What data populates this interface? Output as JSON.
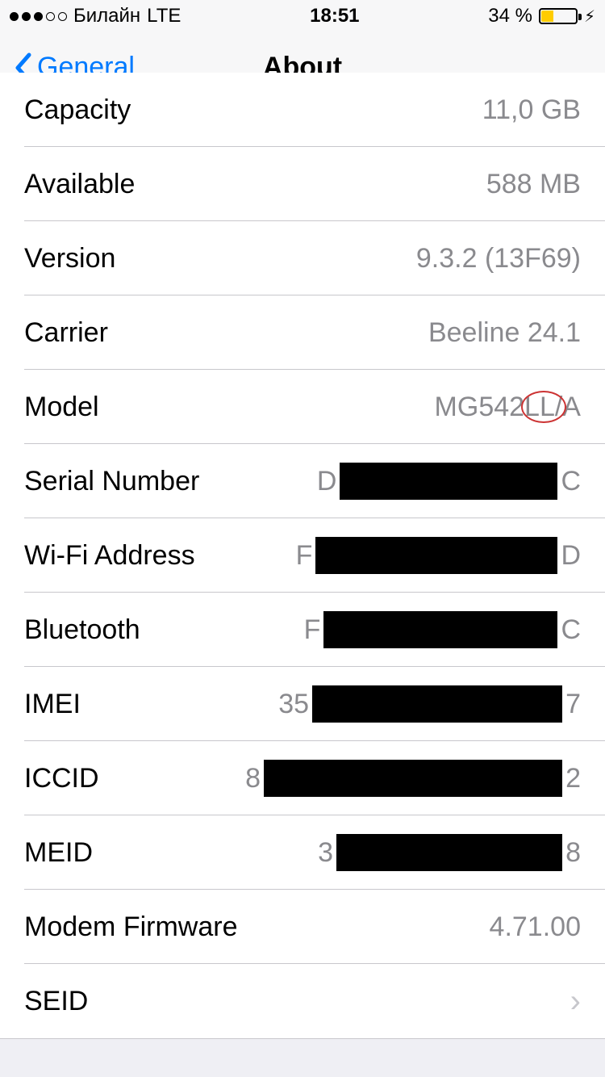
{
  "status": {
    "carrier": "Билайн",
    "network": "LTE",
    "time": "18:51",
    "battery_pct": "34 %"
  },
  "nav": {
    "back_label": "General",
    "title": "About"
  },
  "rows": {
    "capacity": {
      "label": "Capacity",
      "value": "11,0 GB"
    },
    "available": {
      "label": "Available",
      "value": "588 MB"
    },
    "version": {
      "label": "Version",
      "value": "9.3.2 (13F69)"
    },
    "carrier": {
      "label": "Carrier",
      "value": "Beeline 24.1"
    },
    "model": {
      "label": "Model",
      "value": "MG542LL/A"
    },
    "serial": {
      "label": "Serial Number",
      "prefix": "D",
      "suffix": "C"
    },
    "wifi": {
      "label": "Wi-Fi Address",
      "prefix": "F",
      "suffix": "D"
    },
    "bt": {
      "label": "Bluetooth",
      "prefix": "F",
      "suffix": "C"
    },
    "imei": {
      "label": "IMEI",
      "prefix": "35",
      "suffix": "7"
    },
    "iccid": {
      "label": "ICCID",
      "prefix": "8",
      "suffix": "2"
    },
    "meid": {
      "label": "MEID",
      "prefix": "3",
      "suffix": "8"
    },
    "modem": {
      "label": "Modem Firmware",
      "value": "4.71.00"
    },
    "seid": {
      "label": "SEID"
    }
  }
}
